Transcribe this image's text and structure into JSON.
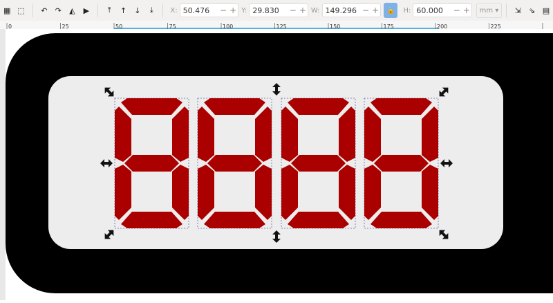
{
  "toolbar": {
    "x_label": "X:",
    "x": "50.476",
    "y_label": "Y:",
    "y": "29.830",
    "w_label": "W:",
    "w": "149.296",
    "h_label": "H:",
    "h": "60.000",
    "unit": "mm",
    "minus": "−",
    "plus": "+"
  },
  "ruler": {
    "ticks": [
      "0",
      "25",
      "50",
      "75",
      "100",
      "125",
      "150",
      "175",
      "200",
      "225"
    ]
  },
  "colors": {
    "segment": "#aa0000",
    "panel": "#ededed",
    "frame": "#000000",
    "selection": "#1a9fd6"
  },
  "display": {
    "digits": 4
  }
}
